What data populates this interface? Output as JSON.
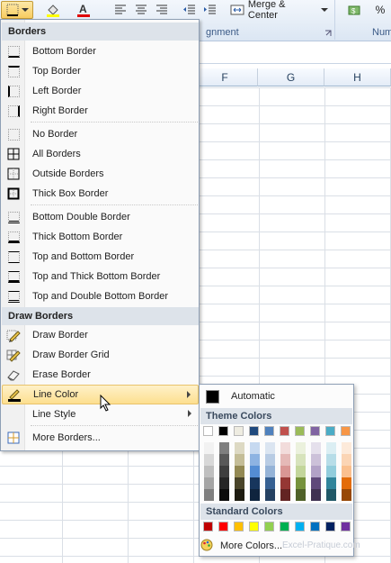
{
  "ribbon": {
    "merge_label": "Merge & Center",
    "group_alignment": "gnment",
    "group_number": "Num",
    "percent": "%"
  },
  "sheet": {
    "columns": [
      "F",
      "G",
      "H"
    ]
  },
  "borders_menu": {
    "header_borders": "Borders",
    "header_draw": "Draw Borders",
    "items": [
      {
        "label": "Bottom Border",
        "icon": "bottom-border-icon"
      },
      {
        "label": "Top Border",
        "icon": "top-border-icon"
      },
      {
        "label": "Left Border",
        "icon": "left-border-icon"
      },
      {
        "label": "Right Border",
        "icon": "right-border-icon"
      },
      {
        "label": "No Border",
        "icon": "no-border-icon"
      },
      {
        "label": "All Borders",
        "icon": "all-borders-icon"
      },
      {
        "label": "Outside Borders",
        "icon": "outside-borders-icon"
      },
      {
        "label": "Thick Box Border",
        "icon": "thick-box-border-icon"
      },
      {
        "label": "Bottom Double Border",
        "icon": "bottom-double-border-icon"
      },
      {
        "label": "Thick Bottom Border",
        "icon": "thick-bottom-border-icon"
      },
      {
        "label": "Top and Bottom Border",
        "icon": "top-bottom-border-icon"
      },
      {
        "label": "Top and Thick Bottom Border",
        "icon": "top-thick-bottom-border-icon"
      },
      {
        "label": "Top and Double Bottom Border",
        "icon": "top-double-bottom-border-icon"
      }
    ],
    "draw_items": [
      {
        "label": "Draw Border",
        "icon": "pencil-icon"
      },
      {
        "label": "Draw Border Grid",
        "icon": "pencil-grid-icon"
      },
      {
        "label": "Erase Border",
        "icon": "eraser-icon"
      },
      {
        "label": "Line Color",
        "icon": "line-color-icon"
      },
      {
        "label": "Line Style",
        "icon": ""
      },
      {
        "label": "More Borders...",
        "icon": "more-borders-icon"
      }
    ]
  },
  "color_menu": {
    "automatic": "Automatic",
    "theme_header": "Theme Colors",
    "standard_header": "Standard Colors",
    "more_colors": "More Colors...",
    "theme_top": [
      "#ffffff",
      "#000000",
      "#eeece1",
      "#1f497d",
      "#4f81bd",
      "#c0504d",
      "#9bbb59",
      "#8064a2",
      "#4bacc6",
      "#f79646"
    ],
    "theme_columns": [
      [
        "#f2f2f2",
        "#d8d8d8",
        "#bfbfbf",
        "#a5a5a5",
        "#7f7f7f"
      ],
      [
        "#7f7f7f",
        "#595959",
        "#3f3f3f",
        "#262626",
        "#0c0c0c"
      ],
      [
        "#ddd9c3",
        "#c4bd97",
        "#938953",
        "#494429",
        "#1d1b10"
      ],
      [
        "#c6d9f0",
        "#8db3e2",
        "#548dd4",
        "#17365d",
        "#0f243e"
      ],
      [
        "#dbe5f1",
        "#b8cce4",
        "#95b3d7",
        "#366092",
        "#244061"
      ],
      [
        "#f2dcdb",
        "#e5b9b7",
        "#d99694",
        "#953734",
        "#632423"
      ],
      [
        "#ebf1dd",
        "#d7e3bc",
        "#c3d69b",
        "#76923c",
        "#4f6128"
      ],
      [
        "#e5e0ec",
        "#ccc1d9",
        "#b2a2c7",
        "#5f497a",
        "#3f3151"
      ],
      [
        "#dbeef3",
        "#b7dde8",
        "#92cddc",
        "#31859b",
        "#205867"
      ],
      [
        "#fdeada",
        "#fbd5b5",
        "#fac08f",
        "#e36c09",
        "#974806"
      ]
    ],
    "standard": [
      "#c00000",
      "#ff0000",
      "#ffc000",
      "#ffff00",
      "#92d050",
      "#00b050",
      "#00b0f0",
      "#0070c0",
      "#002060",
      "#7030a0"
    ]
  },
  "watermark": "Excel-Pratique.com"
}
